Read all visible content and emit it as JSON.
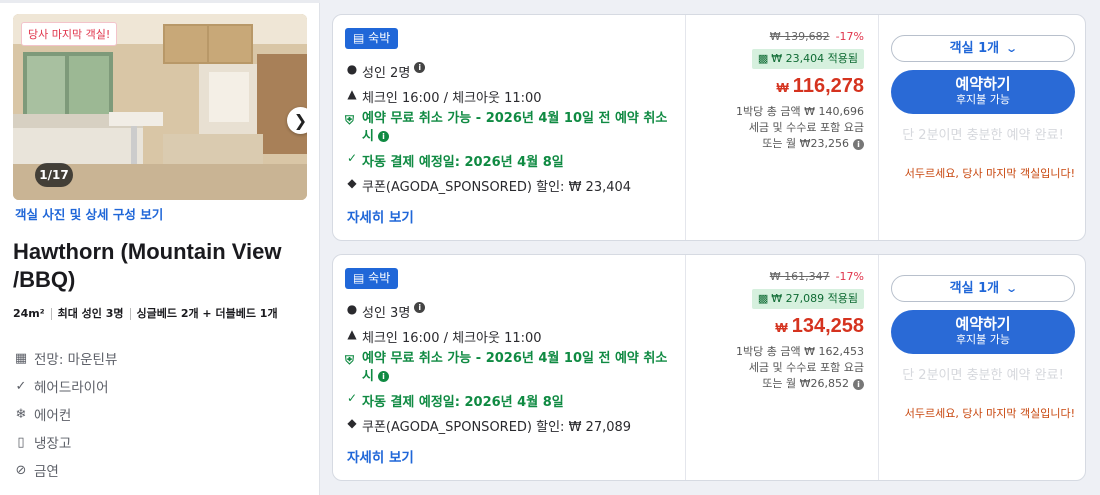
{
  "room": {
    "badge": "당사 마지막 객실!",
    "photo_counter": "1/17",
    "photo_link": "객실 사진 및 상세 구성 보기",
    "title": "Hawthorn (Mountain View /BBQ)",
    "specs": {
      "area": "24m²",
      "max_adults": "최대 성인 3명",
      "beds": "싱글베드 2개 + 더블베드 1개"
    },
    "amenities": [
      {
        "icon": "mountain-view-icon",
        "label": "전망: 마운틴뷰"
      },
      {
        "icon": "check-icon",
        "label": "헤어드라이어"
      },
      {
        "icon": "snowflake-icon",
        "label": "에어컨"
      },
      {
        "icon": "fridge-icon",
        "label": "냉장고"
      },
      {
        "icon": "no-smoking-icon",
        "label": "금연"
      }
    ]
  },
  "offers": [
    {
      "type_badge": "숙박",
      "guests": "성인 2명",
      "checkin": "체크인 16:00 / 체크아웃 11:00",
      "free_cancel": "예약 무료 취소 가능 - 2026년 4월 10일 전 예약 취소 시",
      "auto_pay": "자동 결제 예정일: 2026년 4월 8일",
      "coupon": "쿠폰(AGODA_SPONSORED) 할인: ₩ 23,404",
      "more": "자세히 보기",
      "orig_price": "₩ 139,682",
      "discount_pct": "-17%",
      "coupon_applied": "₩ 23,404 적용됨",
      "currency": "₩",
      "price": "116,278",
      "note1": "1박당 총 금액 ₩ 140,696",
      "note2": "세금 및 수수료 포함 요금",
      "note3": "또는 월 ₩23,256",
      "room_count": "객실 1개",
      "book_label": "예약하기",
      "book_sub": "후지불 가능",
      "faint_text": "단 2분이면 충분한 예약 완료!",
      "hurry_text": "서두르세요, 당사 마지막 객실입니다!"
    },
    {
      "type_badge": "숙박",
      "guests": "성인 3명",
      "checkin": "체크인 16:00 / 체크아웃 11:00",
      "free_cancel": "예약 무료 취소 가능 - 2026년 4월 10일 전 예약 취소 시",
      "auto_pay": "자동 결제 예정일: 2026년 4월 8일",
      "coupon": "쿠폰(AGODA_SPONSORED) 할인: ₩ 27,089",
      "more": "자세히 보기",
      "orig_price": "₩ 161,347",
      "discount_pct": "-17%",
      "coupon_applied": "₩ 27,089 적용됨",
      "currency": "₩",
      "price": "134,258",
      "note1": "1박당 총 금액 ₩ 162,453",
      "note2": "세금 및 수수료 포함 요금",
      "note3": "또는 월 ₩26,852",
      "room_count": "객실 1개",
      "book_label": "예약하기",
      "book_sub": "후지불 가능",
      "faint_text": "단 2분이면 충분한 예약 완료!",
      "hurry_text": "서두르세요, 당사 마지막 객실입니다!"
    }
  ],
  "colors": {
    "accent": "#2067d8",
    "price_red": "#d5331f",
    "green": "#0f8a42",
    "hurry": "#c8470e"
  }
}
